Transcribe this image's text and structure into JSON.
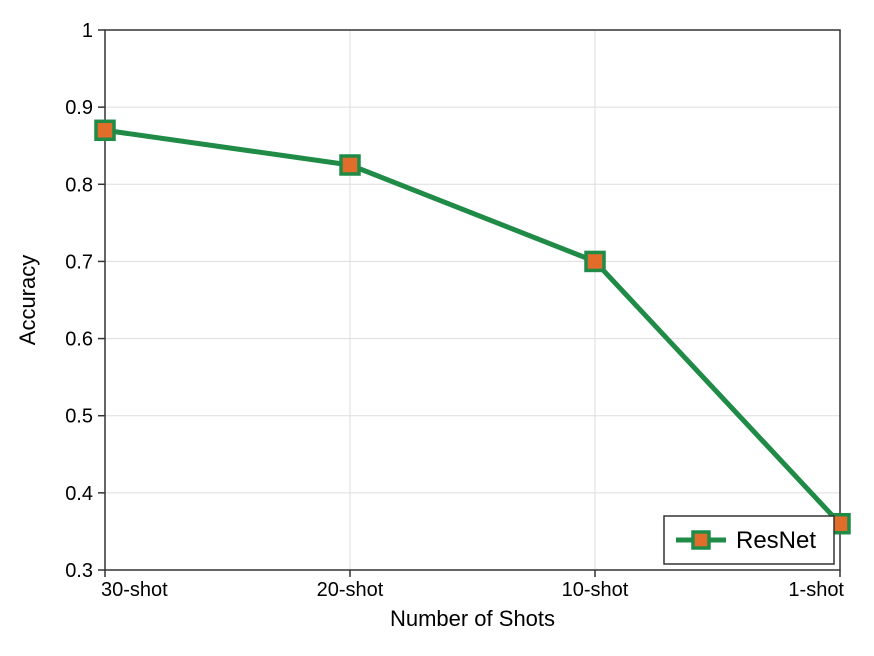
{
  "chart_data": {
    "type": "line",
    "categories": [
      "30-shot",
      "20-shot",
      "10-shot",
      "1-shot"
    ],
    "series": [
      {
        "name": "ResNet",
        "values": [
          0.87,
          0.825,
          0.7,
          0.36
        ],
        "color": "#1f8b47",
        "marker_fill": "#e26c2a",
        "marker_stroke": "#1f8b47"
      }
    ],
    "xlabel": "Number of Shots",
    "ylabel": "Accuracy",
    "title": "",
    "ylim": [
      0.3,
      1.0
    ],
    "yticks": [
      0.3,
      0.4,
      0.5,
      0.6,
      0.7,
      0.8,
      0.9,
      1.0
    ],
    "xlim_index": [
      0,
      3
    ],
    "legend_position": "bottom-right",
    "grid": true,
    "colors": {
      "grid": "#dddddd",
      "axis_border": "#333333",
      "background": "#ffffff"
    }
  }
}
